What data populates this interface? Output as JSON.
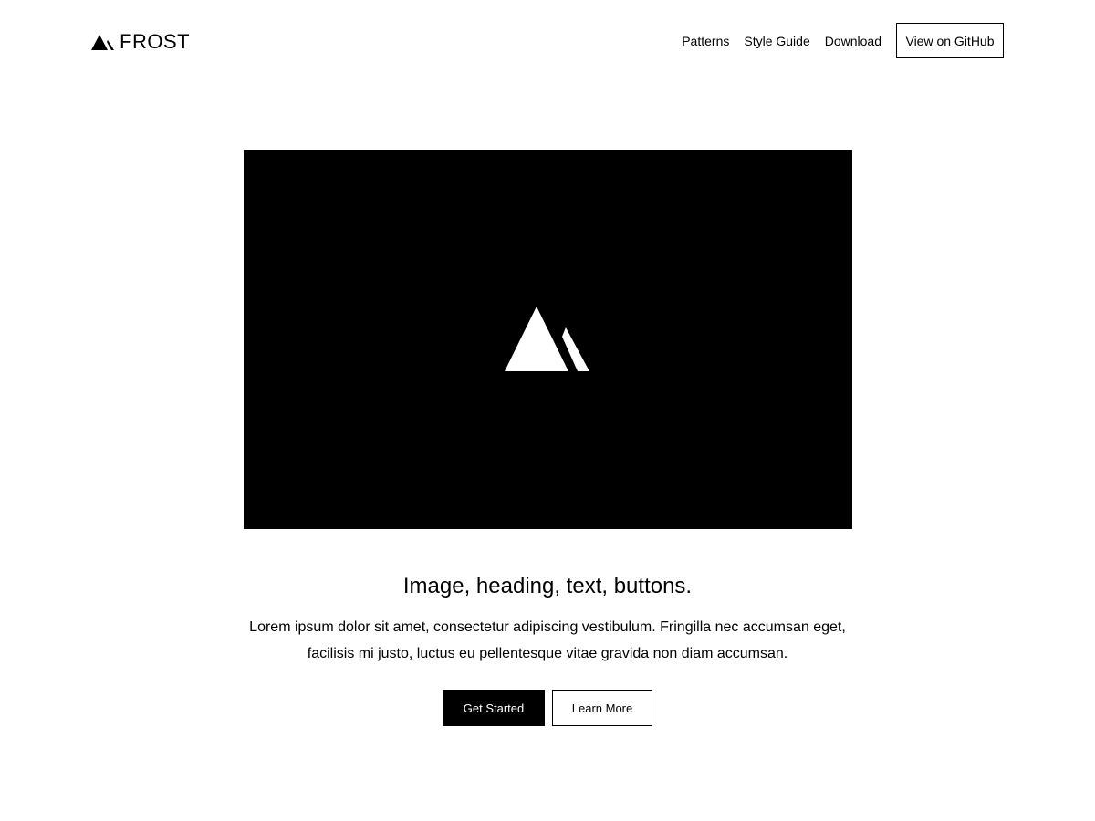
{
  "header": {
    "logo_text": "FROST",
    "nav": [
      {
        "label": "Patterns"
      },
      {
        "label": "Style Guide"
      },
      {
        "label": "Download"
      }
    ],
    "github_button": "View on GitHub"
  },
  "hero": {
    "heading": "Image, heading, text, buttons.",
    "body": "Lorem ipsum dolor sit amet, consectetur adipiscing vestibulum. Fringilla nec accumsan eget, facilisis mi justo, luctus eu pellentesque vitae gravida non diam accumsan.",
    "primary_button": "Get Started",
    "secondary_button": "Learn More"
  },
  "colors": {
    "background": "#ffffff",
    "foreground": "#000000"
  }
}
